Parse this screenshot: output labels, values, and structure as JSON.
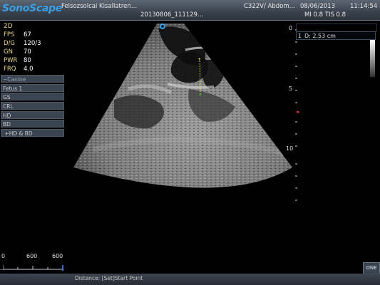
{
  "header": {
    "brand": "SonoScape",
    "patient_name": "Felsozsolcai Kisallatren…",
    "exam_id": "20130806_111129…",
    "probe": "C322V/ Abdom…",
    "date": "08/06/2013",
    "time": "11:14:54",
    "indices": "MI 0.8  TIS 0.8"
  },
  "imaging": {
    "mode": "2D",
    "params": [
      {
        "key": "FPS",
        "value": "67"
      },
      {
        "key": "D/G",
        "value": "120/3"
      },
      {
        "key": "GN",
        "value": "70"
      },
      {
        "key": "PWR",
        "value": "80"
      },
      {
        "key": "FRQ",
        "value": "4.0"
      }
    ]
  },
  "menu": {
    "items": [
      {
        "label": "Canine",
        "prefix": "−"
      },
      {
        "label": "Fetus 1",
        "prefix": ""
      },
      {
        "label": "GS",
        "prefix": ""
      },
      {
        "label": "CRL",
        "prefix": ""
      },
      {
        "label": "HD",
        "prefix": ""
      },
      {
        "label": "BD",
        "prefix": ""
      },
      {
        "label": "HD & BD",
        "prefix": "+"
      }
    ]
  },
  "depth_ruler": {
    "labels": [
      "0",
      "5",
      "10"
    ]
  },
  "measurement": {
    "index": "1",
    "text": "D: 2.53   cm"
  },
  "scale": {
    "labels": [
      "0",
      "600",
      "600"
    ]
  },
  "status_bar": {
    "text": "Distance: [Set]Start Point"
  },
  "buttons": {
    "one": "ONE"
  },
  "colors": {
    "brand": "#3aa0e6",
    "label": "#e9d78a",
    "marker_yellow": "#e8e83a",
    "marker_green": "#3ad03a",
    "focus_red": "#e03030"
  },
  "icons": [
    "orientation-marker-icon",
    "measurement-cursor-icon"
  ]
}
